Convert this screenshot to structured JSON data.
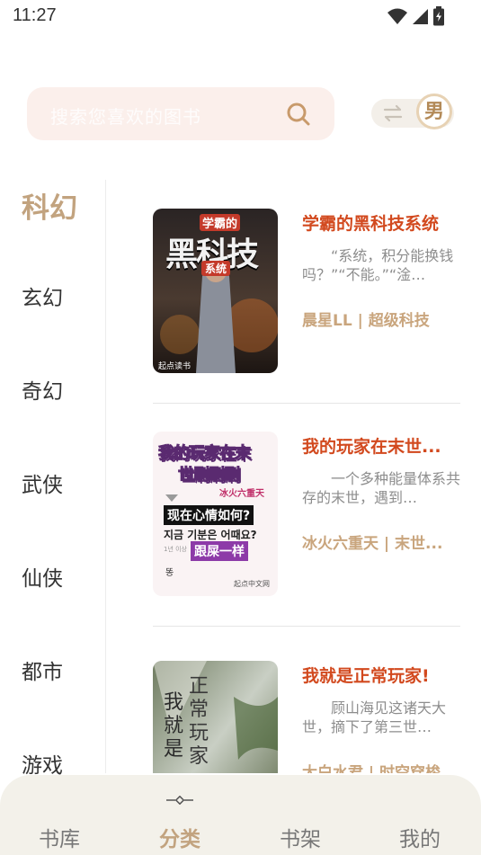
{
  "status_bar": {
    "time": "11:27"
  },
  "search": {
    "placeholder": "搜索您喜欢的图书"
  },
  "gender": {
    "label": "男"
  },
  "categories": [
    {
      "label": "科幻",
      "active": true
    },
    {
      "label": "玄幻"
    },
    {
      "label": "奇幻"
    },
    {
      "label": "武侠"
    },
    {
      "label": "仙侠"
    },
    {
      "label": "都市"
    },
    {
      "label": "游戏"
    }
  ],
  "books": [
    {
      "title": "学霸的黑科技系统",
      "description": "“系统，积分能换钱吗？”“不能。”“淦…",
      "meta": "晨星LL | 超级科技",
      "cover": {
        "top_text": "学霸的",
        "main_text": "黑科技",
        "sub_text": "系统",
        "badge": "起点读书"
      }
    },
    {
      "title": "我的玩家在末世...",
      "description": "一个多种能量体系共存的末世，遇到…",
      "meta": "冰火六重天 | 末世...",
      "cover": {
        "title_line1": "我的玩家在末",
        "title_line2": "世刷刷刷",
        "author": "冰火六重天",
        "bubble1": "现在心情如何?",
        "bubble2": "지금 기분은 어때요?",
        "bubble3": "跟屎一样",
        "small1": "1년 이상",
        "small2": "똥",
        "badge": "起点中文网"
      }
    },
    {
      "title": "我就是正常玩家!",
      "description": "顾山海见这诸天大世，摘下了第三世…",
      "meta": "大白水君 | 时空穿梭",
      "cover": {
        "col1": "我就是",
        "col2": "正常玩家"
      }
    }
  ],
  "nav": [
    {
      "label": "书库"
    },
    {
      "label": "分类",
      "active": true
    },
    {
      "label": "书架"
    },
    {
      "label": "我的"
    }
  ]
}
